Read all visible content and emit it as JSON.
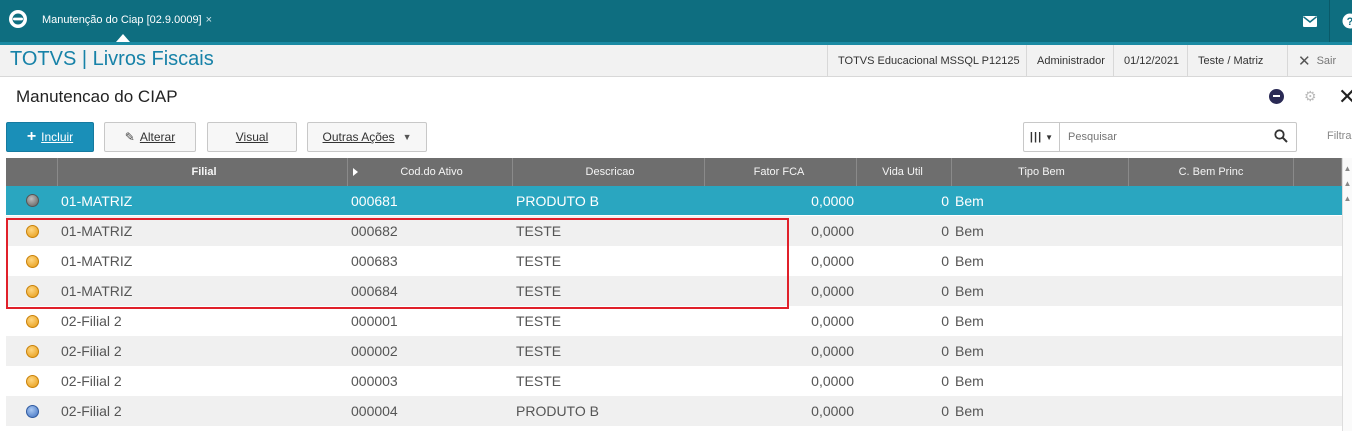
{
  "topbar": {
    "tab_label": "Manutenção do Ciap [02.9.0009]",
    "tab_close": "×"
  },
  "header": {
    "app_title": "TOTVS | Livros Fiscais",
    "environment": "TOTVS Educacional MSSQL P12125",
    "user": "Administrador",
    "date": "01/12/2021",
    "branch": "Teste / Matriz",
    "exit_label": "Sair"
  },
  "page": {
    "title": "Manutencao do CIAP"
  },
  "toolbar": {
    "incluir_label": "Incluir",
    "alterar_label": "Alterar",
    "visual_label": "Visual",
    "outras_label": "Outras Ações",
    "search_placeholder": "Pesquisar",
    "filtrar_label": "Filtrar"
  },
  "grid": {
    "columns": [
      "",
      "Filial",
      "Cod.do Ativo",
      "Descricao",
      "Fator FCA",
      "Vida Util",
      "Tipo Bem",
      "C. Bem Princ",
      ""
    ],
    "rows": [
      {
        "status": "grey",
        "filial": "01-MATRIZ",
        "cod": "000681",
        "descricao": "PRODUTO B",
        "fator": "0,0000",
        "vida": "0",
        "tipo": "Bem",
        "cbem": ""
      },
      {
        "status": "orange",
        "filial": "01-MATRIZ",
        "cod": "000682",
        "descricao": "TESTE",
        "fator": "0,0000",
        "vida": "0",
        "tipo": "Bem",
        "cbem": ""
      },
      {
        "status": "orange",
        "filial": "01-MATRIZ",
        "cod": "000683",
        "descricao": "TESTE",
        "fator": "0,0000",
        "vida": "0",
        "tipo": "Bem",
        "cbem": ""
      },
      {
        "status": "orange",
        "filial": "01-MATRIZ",
        "cod": "000684",
        "descricao": "TESTE",
        "fator": "0,0000",
        "vida": "0",
        "tipo": "Bem",
        "cbem": ""
      },
      {
        "status": "orange",
        "filial": "02-Filial 2",
        "cod": "000001",
        "descricao": "TESTE",
        "fator": "0,0000",
        "vida": "0",
        "tipo": "Bem",
        "cbem": ""
      },
      {
        "status": "orange",
        "filial": "02-Filial 2",
        "cod": "000002",
        "descricao": "TESTE",
        "fator": "0,0000",
        "vida": "0",
        "tipo": "Bem",
        "cbem": ""
      },
      {
        "status": "orange",
        "filial": "02-Filial 2",
        "cod": "000003",
        "descricao": "TESTE",
        "fator": "0,0000",
        "vida": "0",
        "tipo": "Bem",
        "cbem": ""
      },
      {
        "status": "blue",
        "filial": "02-Filial 2",
        "cod": "000004",
        "descricao": "PRODUTO B",
        "fator": "0,0000",
        "vida": "0",
        "tipo": "Bem",
        "cbem": ""
      }
    ]
  }
}
